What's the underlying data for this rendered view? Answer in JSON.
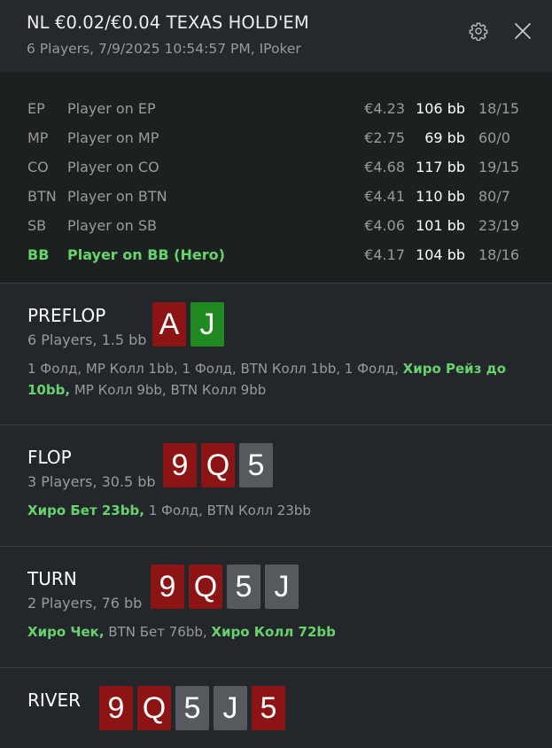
{
  "header": {
    "title": "NL €0.02/€0.04 TEXAS HOLD'EM",
    "subtitle": "6 Players, 7/9/2025 10:54:57 PM, IPoker",
    "settings_icon": "gear-icon",
    "close_icon": "close-icon"
  },
  "players": [
    {
      "pos": "EP",
      "name": "Player on EP",
      "stack": "€4.23",
      "bb": "106 bb",
      "stat": "18/15",
      "hero": false
    },
    {
      "pos": "MP",
      "name": "Player on MP",
      "stack": "€2.75",
      "bb": "69 bb",
      "stat": "60/0",
      "hero": false
    },
    {
      "pos": "CO",
      "name": "Player on CO",
      "stack": "€4.68",
      "bb": "117 bb",
      "stat": "19/15",
      "hero": false
    },
    {
      "pos": "BTN",
      "name": "Player on BTN",
      "stack": "€4.41",
      "bb": "110 bb",
      "stat": "80/7",
      "hero": false
    },
    {
      "pos": "SB",
      "name": "Player on SB",
      "stack": "€4.06",
      "bb": "101 bb",
      "stat": "23/19",
      "hero": false
    },
    {
      "pos": "BB",
      "name": "Player on BB (Hero)",
      "stack": "€4.17",
      "bb": "104 bb",
      "stat": "18/16",
      "hero": true
    }
  ],
  "streets": {
    "preflop": {
      "name": "PREFLOP",
      "info": "6 Players, 1.5 bb",
      "cards": [
        {
          "rank": "A",
          "suit_color": "#8c1414"
        },
        {
          "rank": "J",
          "suit_color": "#1f8a1f"
        }
      ],
      "actions": {
        "a1": "1 Фолд, MP Колл 1bb, 1 Фолд, BTN Колл 1bb, 1 Фолд, ",
        "hero1": "Хиро Рейз до 10bb,",
        "a2": " MP Колл 9bb, BTN Колл 9bb"
      }
    },
    "flop": {
      "name": "FLOP",
      "info": "3 Players, 30.5 bb",
      "cards": [
        {
          "rank": "9",
          "suit_color": "#8c1414"
        },
        {
          "rank": "Q",
          "suit_color": "#8c1414"
        },
        {
          "rank": "5",
          "suit_color": "#565a5e"
        }
      ],
      "actions": {
        "hero1": "Хиро Бет 23bb,",
        "a1": " 1 Фолд, BTN Колл 23bb"
      }
    },
    "turn": {
      "name": "TURN",
      "info": "2 Players, 76 bb",
      "cards": [
        {
          "rank": "9",
          "suit_color": "#8c1414"
        },
        {
          "rank": "Q",
          "suit_color": "#8c1414"
        },
        {
          "rank": "5",
          "suit_color": "#565a5e"
        },
        {
          "rank": "J",
          "suit_color": "#565a5e"
        }
      ],
      "actions": {
        "hero1": "Хиро Чек,",
        "a1": " BTN Бет 76bb, ",
        "hero2": "Хиро Колл 72bb"
      }
    },
    "river": {
      "name": "RIVER",
      "cards": [
        {
          "rank": "9",
          "suit_color": "#8c1414"
        },
        {
          "rank": "Q",
          "suit_color": "#8c1414"
        },
        {
          "rank": "5",
          "suit_color": "#565a5e"
        },
        {
          "rank": "J",
          "suit_color": "#565a5e"
        },
        {
          "rank": "5",
          "suit_color": "#8c1414"
        }
      ]
    }
  }
}
